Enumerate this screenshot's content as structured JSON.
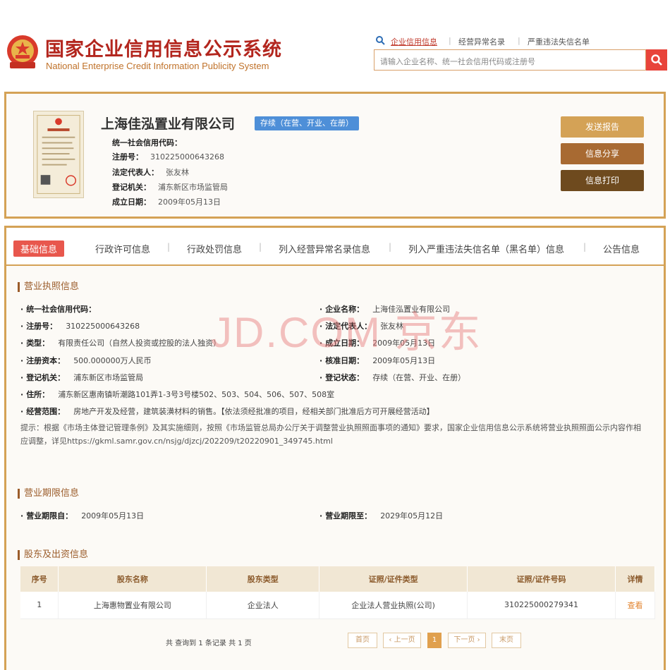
{
  "header": {
    "title": "国家企业信用信息公示系统",
    "subtitle": "National Enterprise Credit Information Publicity System",
    "links": [
      "企业信用信息",
      "经营异常名录",
      "严重违法失信名单"
    ],
    "search_placeholder": "请输入企业名称、统一社会信用代码或注册号"
  },
  "company": {
    "name": "上海佳泓置业有限公司",
    "status": "存续（在营、开业、在册）",
    "rows": [
      {
        "label": "统一社会信用代码：",
        "value": ""
      },
      {
        "label": "注册号：",
        "value": "310225000643268"
      },
      {
        "label": "法定代表人：",
        "value": "张友林"
      },
      {
        "label": "登记机关：",
        "value": "浦东新区市场监管局"
      },
      {
        "label": "成立日期：",
        "value": "2009年05月13日"
      }
    ],
    "actions": [
      "发送报告",
      "信息分享",
      "信息打印"
    ]
  },
  "tabs": [
    "基础信息",
    "行政许可信息",
    "行政处罚信息",
    "列入经营异常名录信息",
    "列入严重违法失信名单（黑名单）信息",
    "公告信息"
  ],
  "license": {
    "title": "营业执照信息",
    "left": [
      {
        "label": "统一社会信用代码：",
        "value": ""
      },
      {
        "label": "注册号：",
        "value": "310225000643268"
      },
      {
        "label": "类型：",
        "value": "有限责任公司（自然人投资或控股的法人独资）"
      },
      {
        "label": "注册资本：",
        "value": "500.000000万人民币"
      },
      {
        "label": "登记机关：",
        "value": "浦东新区市场监管局"
      }
    ],
    "right": [
      {
        "label": "企业名称：",
        "value": "上海佳泓置业有限公司"
      },
      {
        "label": "法定代表人：",
        "value": "张友林"
      },
      {
        "label": "成立日期：",
        "value": "2009年05月13日"
      },
      {
        "label": "核准日期：",
        "value": "2009年05月13日"
      },
      {
        "label": "登记状态：",
        "value": "存续（在营、开业、在册）"
      }
    ],
    "address_label": "住所：",
    "address": "浦东新区惠南镇听潮路101弄1-3号3号楼502、503、504、506、507、508室",
    "scope_label": "经营范围：",
    "scope": "房地产开发及经营，建筑装潢材料的销售。【依法须经批准的项目，经相关部门批准后方可开展经营活动】",
    "notice": "提示：根据《市场主体登记管理条例》及其实施细则，按照《市场监管总局办公厅关于调整营业执照照面事项的通知》要求，国家企业信用信息公示系统将营业执照照面公示内容作相应调整，详见https://gkml.samr.gov.cn/nsjg/djzcj/202209/t20220901_349745.html"
  },
  "watermark": "JD.COM 京东",
  "term": {
    "title": "营业期限信息",
    "from_label": "营业期限自：",
    "from": "2009年05月13日",
    "to_label": "营业期限至：",
    "to": "2029年05月12日"
  },
  "shareholders": {
    "title": "股东及出资信息",
    "headers": [
      "序号",
      "股东名称",
      "股东类型",
      "证照/证件类型",
      "证照/证件号码",
      "详情"
    ],
    "rows": [
      {
        "no": "1",
        "name": "上海惠物置业有限公司",
        "type": "企业法人",
        "cert_type": "企业法人营业执照(公司)",
        "cert_no": "310225000279341",
        "detail": "查看"
      }
    ]
  },
  "pagination": {
    "summary": "共 查询到 1 条记录 共 1 页",
    "first": "首页",
    "prev": "‹ 上一页",
    "current": "1",
    "next": "下一页 ›",
    "last": "末页"
  }
}
